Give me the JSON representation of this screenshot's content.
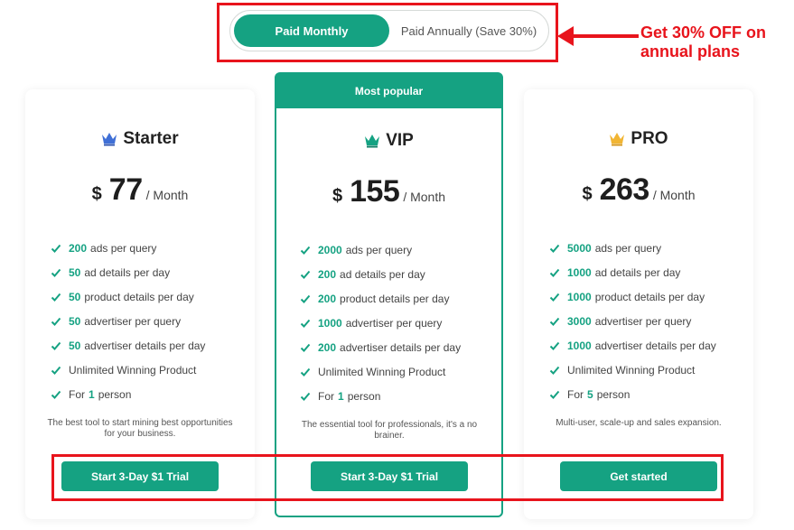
{
  "billing_toggle": {
    "monthly_label": "Paid Monthly",
    "annual_label": "Paid Annually (Save 30%)"
  },
  "annotation": {
    "callout_line1": "Get 30% OFF on",
    "callout_line2": "annual plans"
  },
  "colors": {
    "accent": "#15a282",
    "annotation_red": "#e8141c"
  },
  "plans": [
    {
      "name": "Starter",
      "crown_icon": "crown-blue-icon",
      "currency": "$",
      "price": "77",
      "period": "/ Month",
      "features": [
        {
          "value": "200",
          "text": "ads per query"
        },
        {
          "value": "50",
          "text": "ad details per day"
        },
        {
          "value": "50",
          "text": "product details per day"
        },
        {
          "value": "50",
          "text": "advertiser per query"
        },
        {
          "value": "50",
          "text": "advertiser details per day"
        },
        {
          "value": "",
          "text": "Unlimited Winning Product"
        },
        {
          "prefix": "For",
          "value": "1",
          "text": "person"
        }
      ],
      "description": "The best tool to start mining best opportunities for your business.",
      "cta": "Start 3-Day $1 Trial"
    },
    {
      "badge": "Most popular",
      "name": "VIP",
      "crown_icon": "crown-teal-icon",
      "currency": "$",
      "price": "155",
      "period": "/ Month",
      "features": [
        {
          "value": "2000",
          "text": "ads per query"
        },
        {
          "value": "200",
          "text": "ad details per day"
        },
        {
          "value": "200",
          "text": "product details per day"
        },
        {
          "value": "1000",
          "text": "advertiser per query"
        },
        {
          "value": "200",
          "text": "advertiser details per day"
        },
        {
          "value": "",
          "text": "Unlimited Winning Product"
        },
        {
          "prefix": "For",
          "value": "1",
          "text": "person"
        }
      ],
      "description": "The essential tool for professionals, it's a no brainer.",
      "cta": "Start 3-Day $1 Trial"
    },
    {
      "name": "PRO",
      "crown_icon": "crown-gold-icon",
      "currency": "$",
      "price": "263",
      "period": "/ Month",
      "features": [
        {
          "value": "5000",
          "text": "ads per query"
        },
        {
          "value": "1000",
          "text": "ad details per day"
        },
        {
          "value": "1000",
          "text": "product details per day"
        },
        {
          "value": "3000",
          "text": "advertiser per query"
        },
        {
          "value": "1000",
          "text": "advertiser details per day"
        },
        {
          "value": "",
          "text": "Unlimited Winning Product"
        },
        {
          "prefix": "For",
          "value": "5",
          "text": "person"
        }
      ],
      "description": "Multi-user, scale-up and sales expansion.",
      "cta": "Get started"
    }
  ]
}
